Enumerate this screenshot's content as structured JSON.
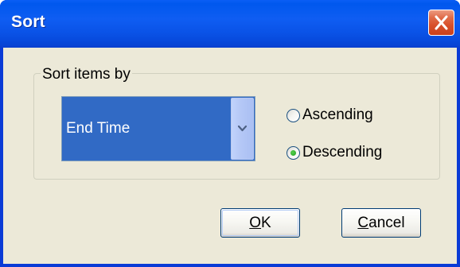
{
  "window": {
    "title": "Sort"
  },
  "icons": {
    "close": "close-icon",
    "dropdown": "chevron-down-icon"
  },
  "group": {
    "legend": "Sort items by"
  },
  "sort_field": {
    "selected": "End Time"
  },
  "order": {
    "options": [
      {
        "label": "Ascending",
        "selected": false
      },
      {
        "label": "Descending",
        "selected": true
      }
    ]
  },
  "buttons": {
    "ok": {
      "accel": "O",
      "rest": "K"
    },
    "cancel": {
      "accel": "C",
      "rest": "ancel"
    }
  },
  "colors": {
    "titlebar": "#0058ee",
    "close_button": "#d8502b",
    "dialog_face": "#ece9d8",
    "selection": "#316ac5",
    "radio_dot": "#21a121"
  }
}
